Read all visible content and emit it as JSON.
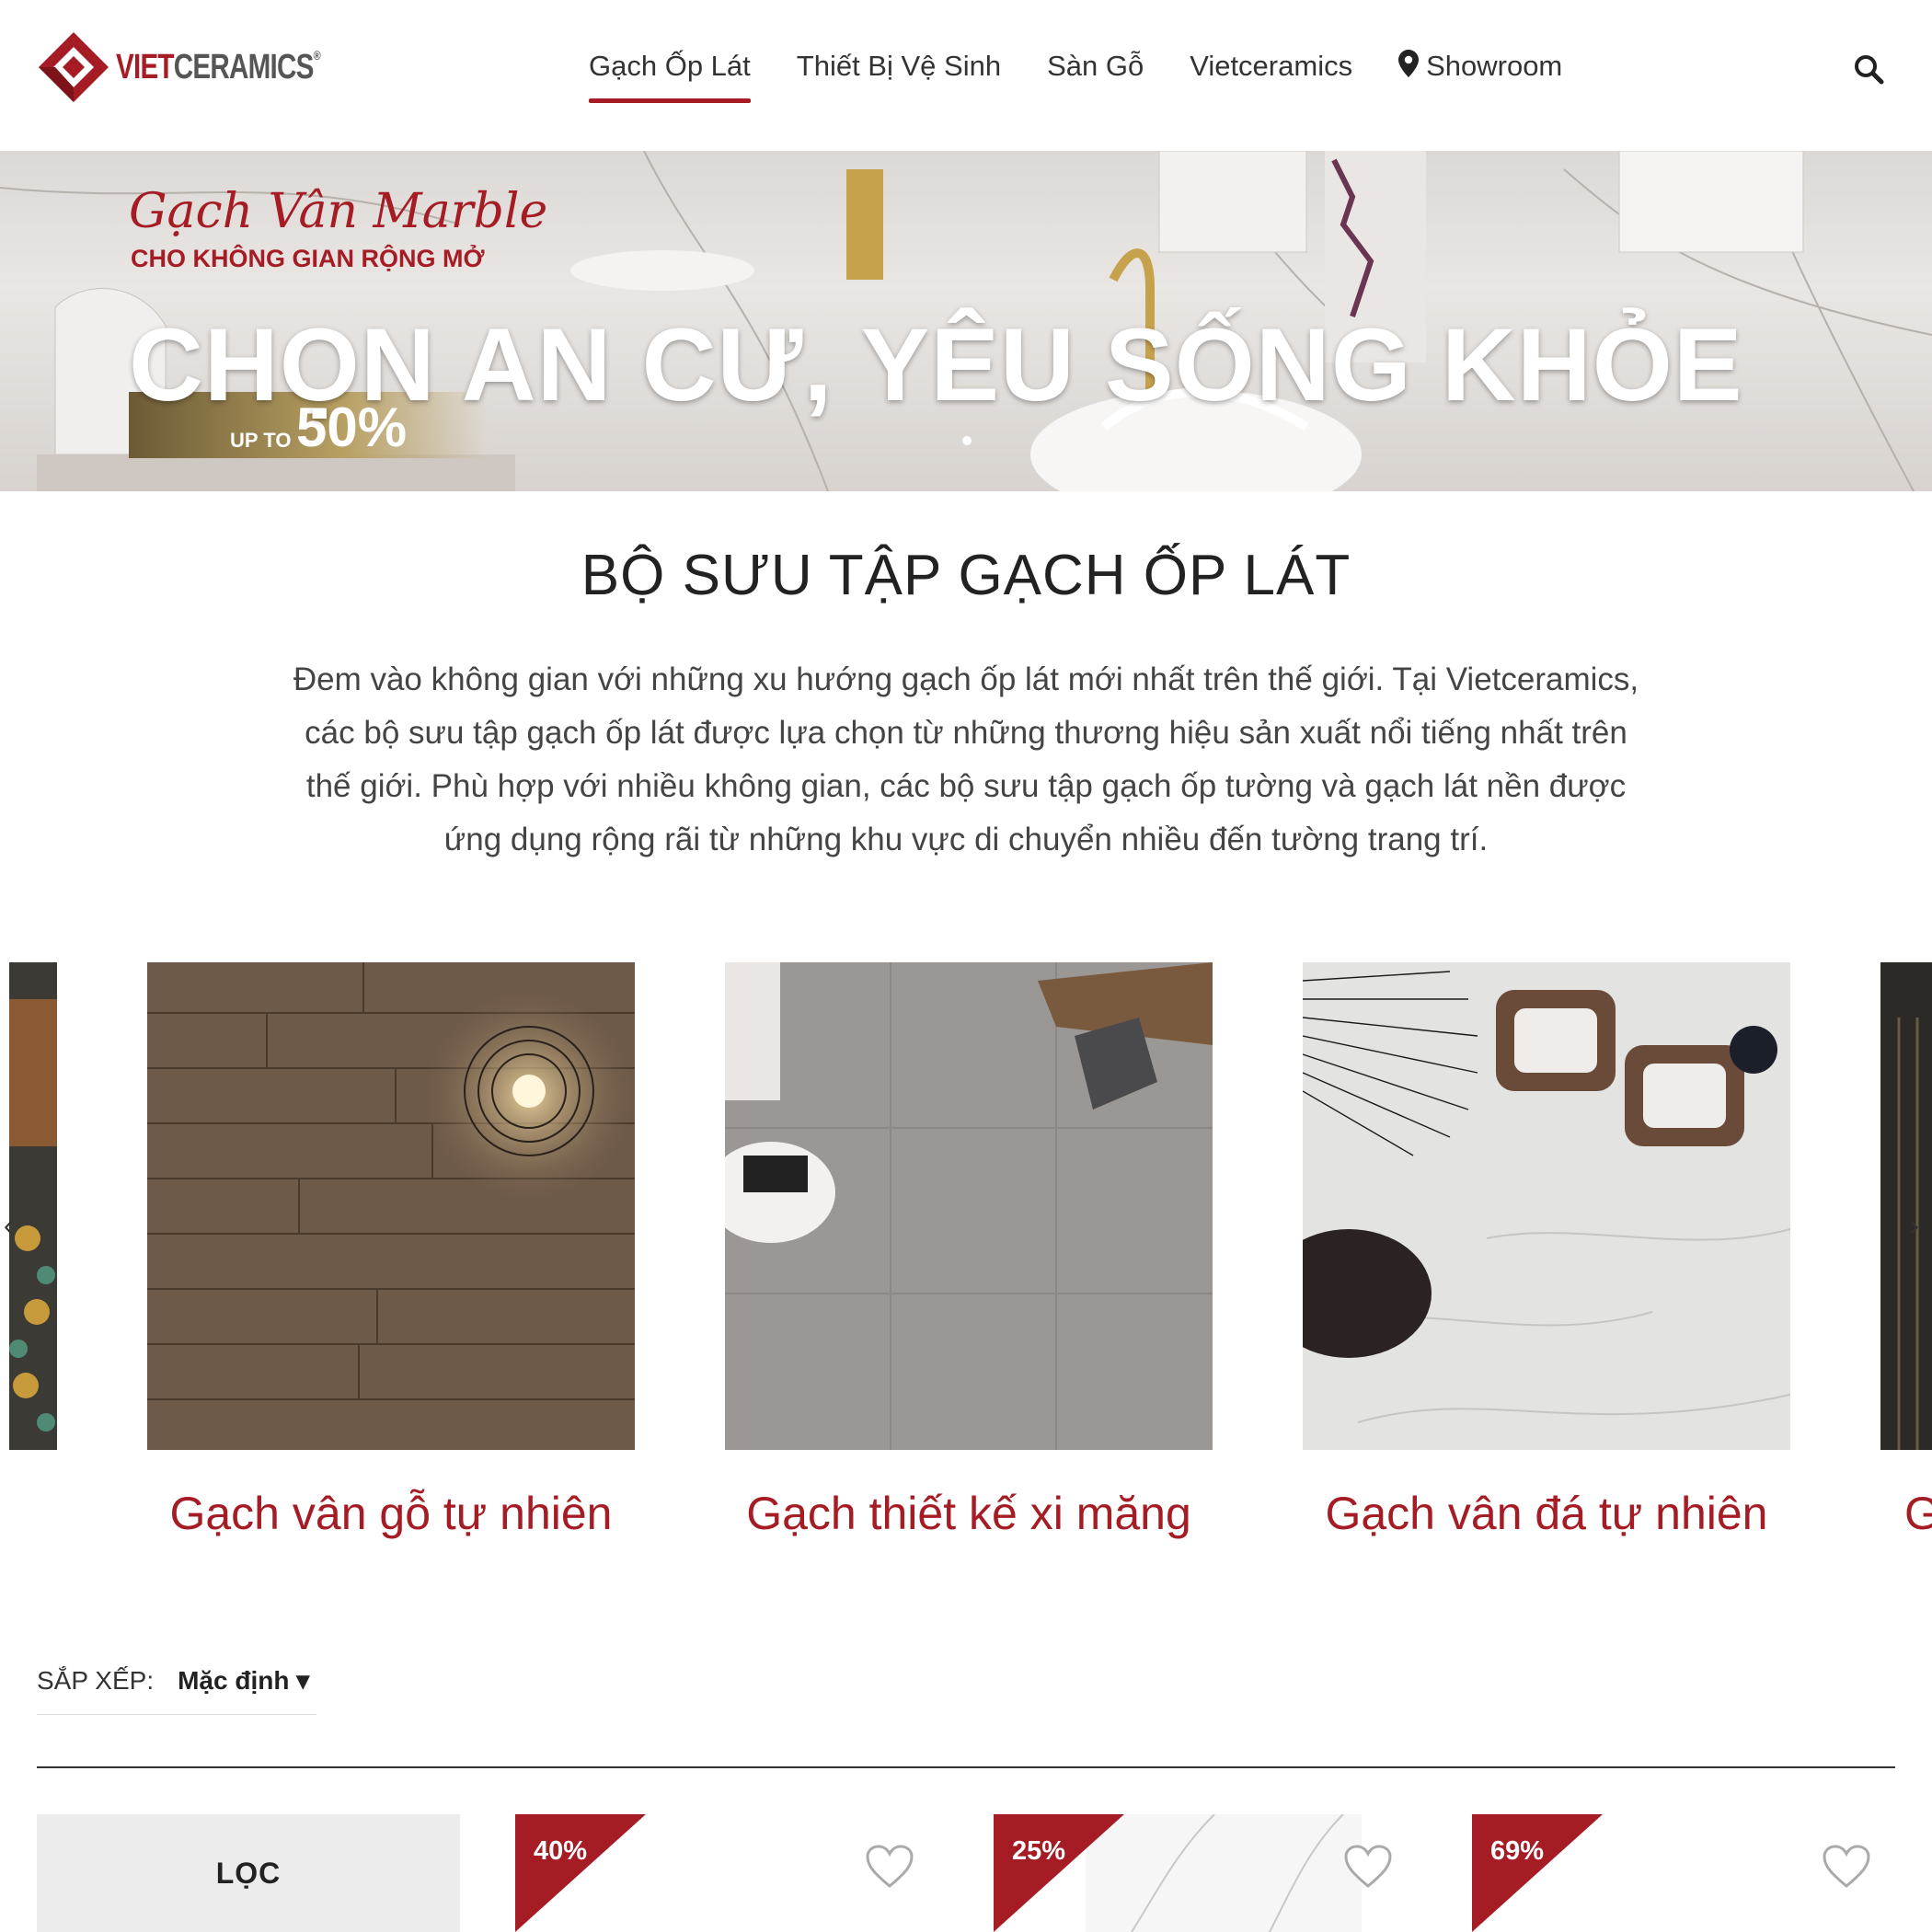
{
  "brand": {
    "name_part1": "VIET",
    "name_part2": "CERAMICS",
    "mark": "®",
    "accent_color": "#a51c24"
  },
  "nav": {
    "items": [
      {
        "label": "Gạch Ốp Lát",
        "active": true
      },
      {
        "label": "Thiết Bị Vệ Sinh"
      },
      {
        "label": "Sàn Gỗ"
      },
      {
        "label": "Vietceramics"
      },
      {
        "label": "Showroom",
        "icon": "location-pin-icon"
      }
    ],
    "search_icon": "search-icon"
  },
  "banner": {
    "script_title": "Gạch Vân Marble",
    "subtitle": "CHO KHÔNG GIAN RỘNG MỞ",
    "headline": "CHỌN AN CƯ, YÊU SỐNG KHỎE",
    "promo_prefix": "UP TO",
    "promo_value": "50%"
  },
  "section": {
    "title": "BỘ SƯU TẬP GẠCH ỐP LÁT",
    "description_lines": [
      "Đem vào không gian với những xu hướng gạch ốp lát mới nhất trên thế giới. Tại Vietceramics,",
      "các bộ sưu tập gạch ốp lát được lựa chọn từ những thương hiệu sản xuất nổi tiếng nhất trên",
      "thế giới. Phù hợp với nhiều không gian, các bộ sưu tập gạch ốp tường và gạch lát nền được",
      "ứng dụng rộng rãi từ những khu vực di chuyển nhiều đến tường trang trí."
    ]
  },
  "categories": [
    {
      "label": "Gạch vân gỗ tự nhiên"
    },
    {
      "label": "Gạch thiết kế xi măng"
    },
    {
      "label": "Gạch vân đá tự nhiên"
    }
  ],
  "carousel": {
    "next_partial_label": "G"
  },
  "sort": {
    "label": "SẮP XẾP:",
    "value": "Mặc định ▾"
  },
  "filter": {
    "label": "LỌC"
  },
  "products": [
    {
      "discount": "40%"
    },
    {
      "discount": "25%"
    },
    {
      "discount": "69%"
    }
  ]
}
